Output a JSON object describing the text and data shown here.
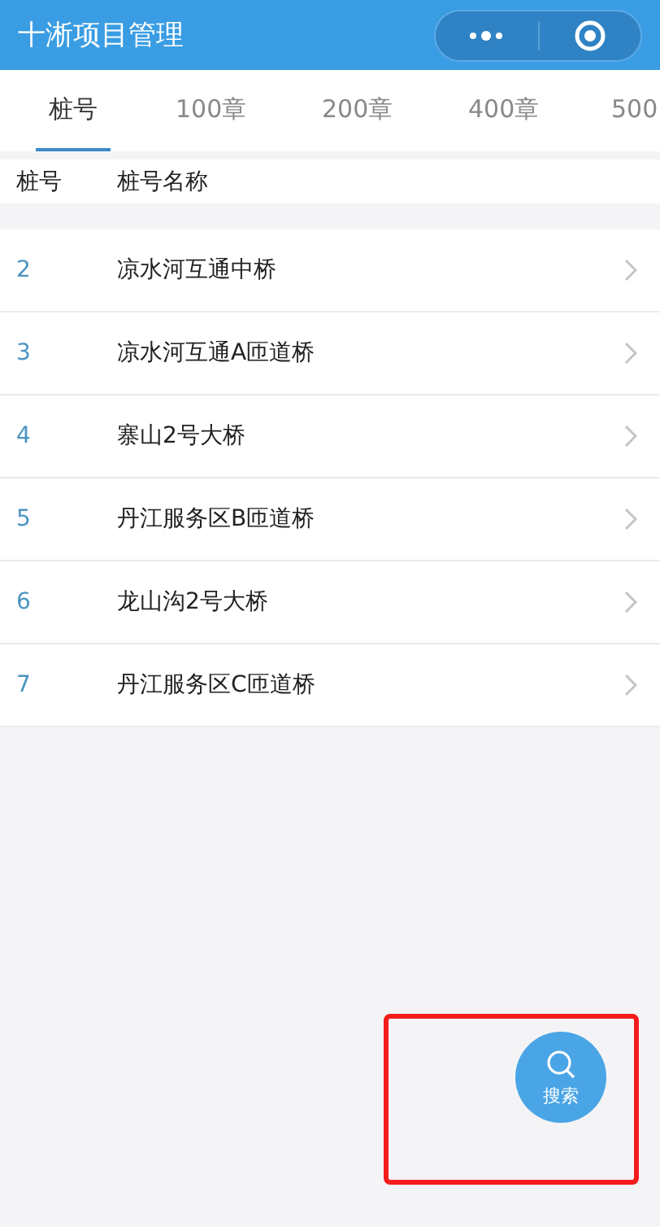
{
  "window": {
    "title": "十淅项目管理"
  },
  "tabs": [
    {
      "label": "桩号",
      "selected": true
    },
    {
      "label": "100章",
      "selected": false
    },
    {
      "label": "200章",
      "selected": false
    },
    {
      "label": "400章",
      "selected": false
    },
    {
      "label": "500",
      "selected": false
    }
  ],
  "table": {
    "columns": [
      "桩号",
      "桩号名称"
    ],
    "rows": [
      {
        "number": "2",
        "name": "凉水河互通中桥"
      },
      {
        "number": "3",
        "name": "凉水河互通A匝道桥"
      },
      {
        "number": "4",
        "name": "寨山2号大桥"
      },
      {
        "number": "5",
        "name": "丹江服务区B匝道桥"
      },
      {
        "number": "6",
        "name": "龙山沟2号大桥"
      },
      {
        "number": "7",
        "name": "丹江服务区C匝道桥"
      }
    ]
  },
  "search_button": {
    "label": "搜索",
    "highlighted": true
  }
}
